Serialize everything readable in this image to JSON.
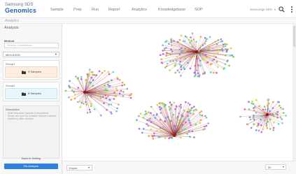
{
  "brand": {
    "top": "Samsung SDS",
    "main": "Genomics"
  },
  "nav": [
    "Sample",
    "Prep",
    "Run",
    "Report",
    "Analytics",
    "Knowledgebase",
    "SOP"
  ],
  "user": {
    "label": "Samsunge SDS"
  },
  "icons": {
    "search": "search-icon",
    "more": "more-vertical-icon",
    "folder": "folder-icon"
  },
  "breadcrumb": "Analytics",
  "sidebar": {
    "title": "Analysis",
    "method_label": "Method",
    "method_value": "Random Compositions",
    "selector_value": "Minh AGDD",
    "groups": [
      {
        "title": "Group1",
        "count": "9 Samples"
      },
      {
        "title": "Group2",
        "count": "8 Samples"
      }
    ],
    "description_title": "Description",
    "description_text": "Multi-Sequence Variants Compositions. Shown are used by mutation-selected variants related by other samples.",
    "back_label": "Back to Setting",
    "primary_label": "Re-Analysis"
  },
  "bottom": {
    "export_label": "Export",
    "zoom_value": "50"
  },
  "colors": {
    "accent": "#2f82d9",
    "brand": "#1f5fae",
    "edge": "#8b1a1a",
    "group1_bg": "#fdeee0",
    "group2_bg": "#e6f6fb",
    "node_palette": [
      "#d3d64a",
      "#7ad14f",
      "#5fa6e6",
      "#b26be0",
      "#e25fb4",
      "#f0a24c",
      "#5fd6cf",
      "#a0a0e6"
    ]
  }
}
